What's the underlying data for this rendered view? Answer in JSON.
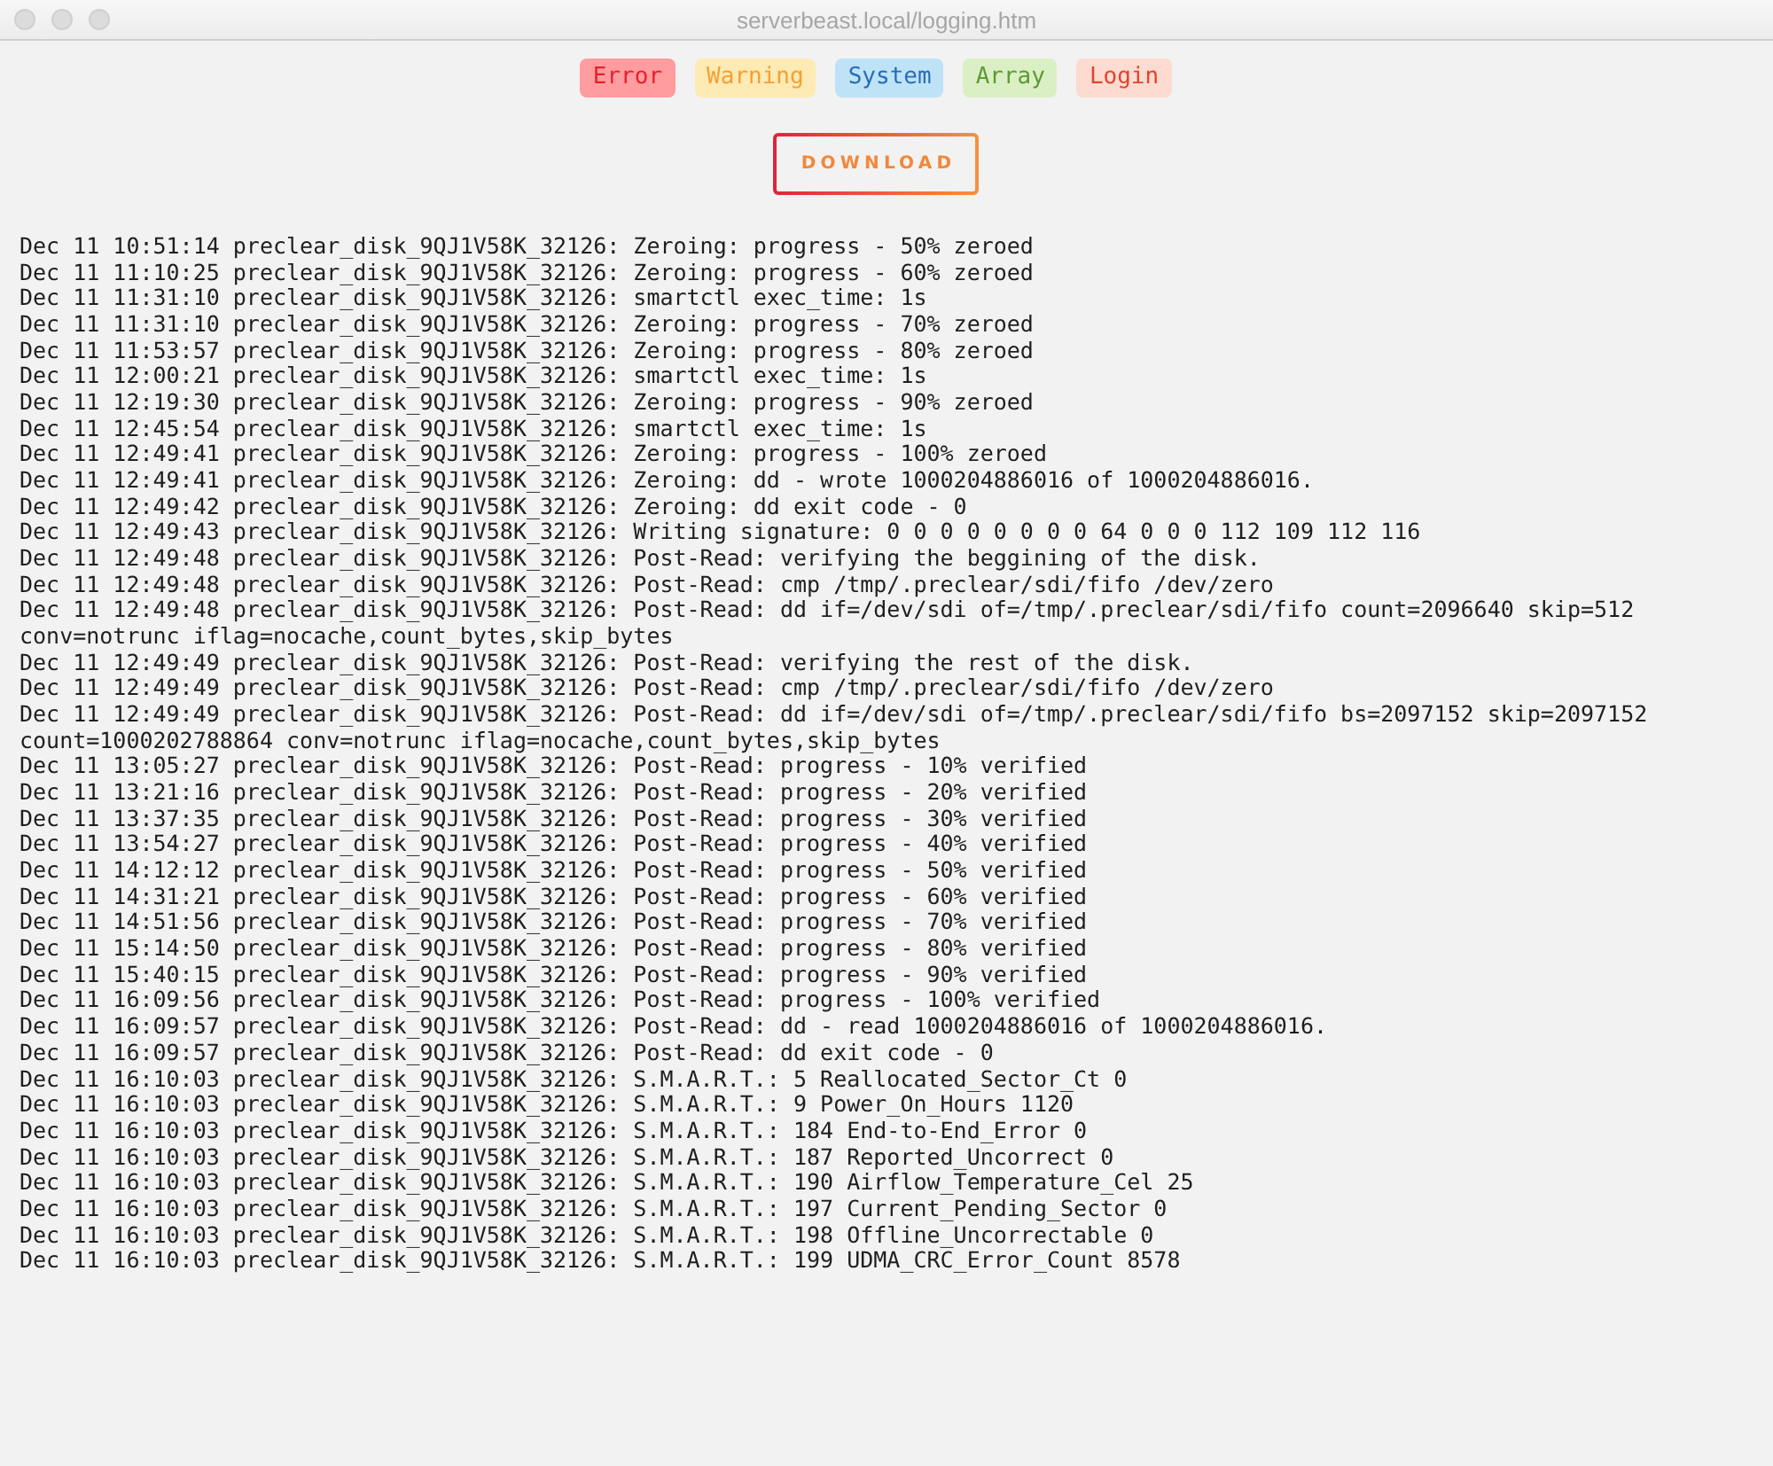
{
  "window": {
    "title": "serverbeast.local/logging.htm"
  },
  "filters": [
    {
      "label": "Error",
      "kind": "error"
    },
    {
      "label": "Warning",
      "kind": "warning"
    },
    {
      "label": "System",
      "kind": "system"
    },
    {
      "label": "Array",
      "kind": "array"
    },
    {
      "label": "Login",
      "kind": "login"
    }
  ],
  "download_button": {
    "label": "DOWNLOAD"
  },
  "log_lines": [
    "Dec 11 10:51:14 preclear_disk_9QJ1V58K_32126: Zeroing: progress - 50% zeroed",
    "Dec 11 11:10:25 preclear_disk_9QJ1V58K_32126: Zeroing: progress - 60% zeroed",
    "Dec 11 11:31:10 preclear_disk_9QJ1V58K_32126: smartctl exec_time: 1s",
    "Dec 11 11:31:10 preclear_disk_9QJ1V58K_32126: Zeroing: progress - 70% zeroed",
    "Dec 11 11:53:57 preclear_disk_9QJ1V58K_32126: Zeroing: progress - 80% zeroed",
    "Dec 11 12:00:21 preclear_disk_9QJ1V58K_32126: smartctl exec_time: 1s",
    "Dec 11 12:19:30 preclear_disk_9QJ1V58K_32126: Zeroing: progress - 90% zeroed",
    "Dec 11 12:45:54 preclear_disk_9QJ1V58K_32126: smartctl exec_time: 1s",
    "Dec 11 12:49:41 preclear_disk_9QJ1V58K_32126: Zeroing: progress - 100% zeroed",
    "Dec 11 12:49:41 preclear_disk_9QJ1V58K_32126: Zeroing: dd - wrote 1000204886016 of 1000204886016.",
    "Dec 11 12:49:42 preclear_disk_9QJ1V58K_32126: Zeroing: dd exit code - 0",
    "Dec 11 12:49:43 preclear_disk_9QJ1V58K_32126: Writing signature: 0 0 0 0 0 0 0 0 64 0 0 0 112 109 112 116",
    "Dec 11 12:49:48 preclear_disk_9QJ1V58K_32126: Post-Read: verifying the beggining of the disk.",
    "Dec 11 12:49:48 preclear_disk_9QJ1V58K_32126: Post-Read: cmp /tmp/.preclear/sdi/fifo /dev/zero",
    "Dec 11 12:49:48 preclear_disk_9QJ1V58K_32126: Post-Read: dd if=/dev/sdi of=/tmp/.preclear/sdi/fifo count=2096640 skip=512 conv=notrunc iflag=nocache,count_bytes,skip_bytes",
    "Dec 11 12:49:49 preclear_disk_9QJ1V58K_32126: Post-Read: verifying the rest of the disk.",
    "Dec 11 12:49:49 preclear_disk_9QJ1V58K_32126: Post-Read: cmp /tmp/.preclear/sdi/fifo /dev/zero",
    "Dec 11 12:49:49 preclear_disk_9QJ1V58K_32126: Post-Read: dd if=/dev/sdi of=/tmp/.preclear/sdi/fifo bs=2097152 skip=2097152 count=1000202788864 conv=notrunc iflag=nocache,count_bytes,skip_bytes",
    "Dec 11 13:05:27 preclear_disk_9QJ1V58K_32126: Post-Read: progress - 10% verified",
    "Dec 11 13:21:16 preclear_disk_9QJ1V58K_32126: Post-Read: progress - 20% verified",
    "Dec 11 13:37:35 preclear_disk_9QJ1V58K_32126: Post-Read: progress - 30% verified",
    "Dec 11 13:54:27 preclear_disk_9QJ1V58K_32126: Post-Read: progress - 40% verified",
    "Dec 11 14:12:12 preclear_disk_9QJ1V58K_32126: Post-Read: progress - 50% verified",
    "Dec 11 14:31:21 preclear_disk_9QJ1V58K_32126: Post-Read: progress - 60% verified",
    "Dec 11 14:51:56 preclear_disk_9QJ1V58K_32126: Post-Read: progress - 70% verified",
    "Dec 11 15:14:50 preclear_disk_9QJ1V58K_32126: Post-Read: progress - 80% verified",
    "Dec 11 15:40:15 preclear_disk_9QJ1V58K_32126: Post-Read: progress - 90% verified",
    "Dec 11 16:09:56 preclear_disk_9QJ1V58K_32126: Post-Read: progress - 100% verified",
    "Dec 11 16:09:57 preclear_disk_9QJ1V58K_32126: Post-Read: dd - read 1000204886016 of 1000204886016.",
    "Dec 11 16:09:57 preclear_disk_9QJ1V58K_32126: Post-Read: dd exit code - 0",
    "Dec 11 16:10:03 preclear_disk_9QJ1V58K_32126: S.M.A.R.T.: 5 Reallocated_Sector_Ct 0",
    "Dec 11 16:10:03 preclear_disk_9QJ1V58K_32126: S.M.A.R.T.: 9 Power_On_Hours 1120",
    "Dec 11 16:10:03 preclear_disk_9QJ1V58K_32126: S.M.A.R.T.: 184 End-to-End_Error 0",
    "Dec 11 16:10:03 preclear_disk_9QJ1V58K_32126: S.M.A.R.T.: 187 Reported_Uncorrect 0",
    "Dec 11 16:10:03 preclear_disk_9QJ1V58K_32126: S.M.A.R.T.: 190 Airflow_Temperature_Cel 25",
    "Dec 11 16:10:03 preclear_disk_9QJ1V58K_32126: S.M.A.R.T.: 197 Current_Pending_Sector 0",
    "Dec 11 16:10:03 preclear_disk_9QJ1V58K_32126: S.M.A.R.T.: 198 Offline_Uncorrectable 0",
    "Dec 11 16:10:03 preclear_disk_9QJ1V58K_32126: S.M.A.R.T.: 199 UDMA_CRC_Error_Count 8578"
  ]
}
